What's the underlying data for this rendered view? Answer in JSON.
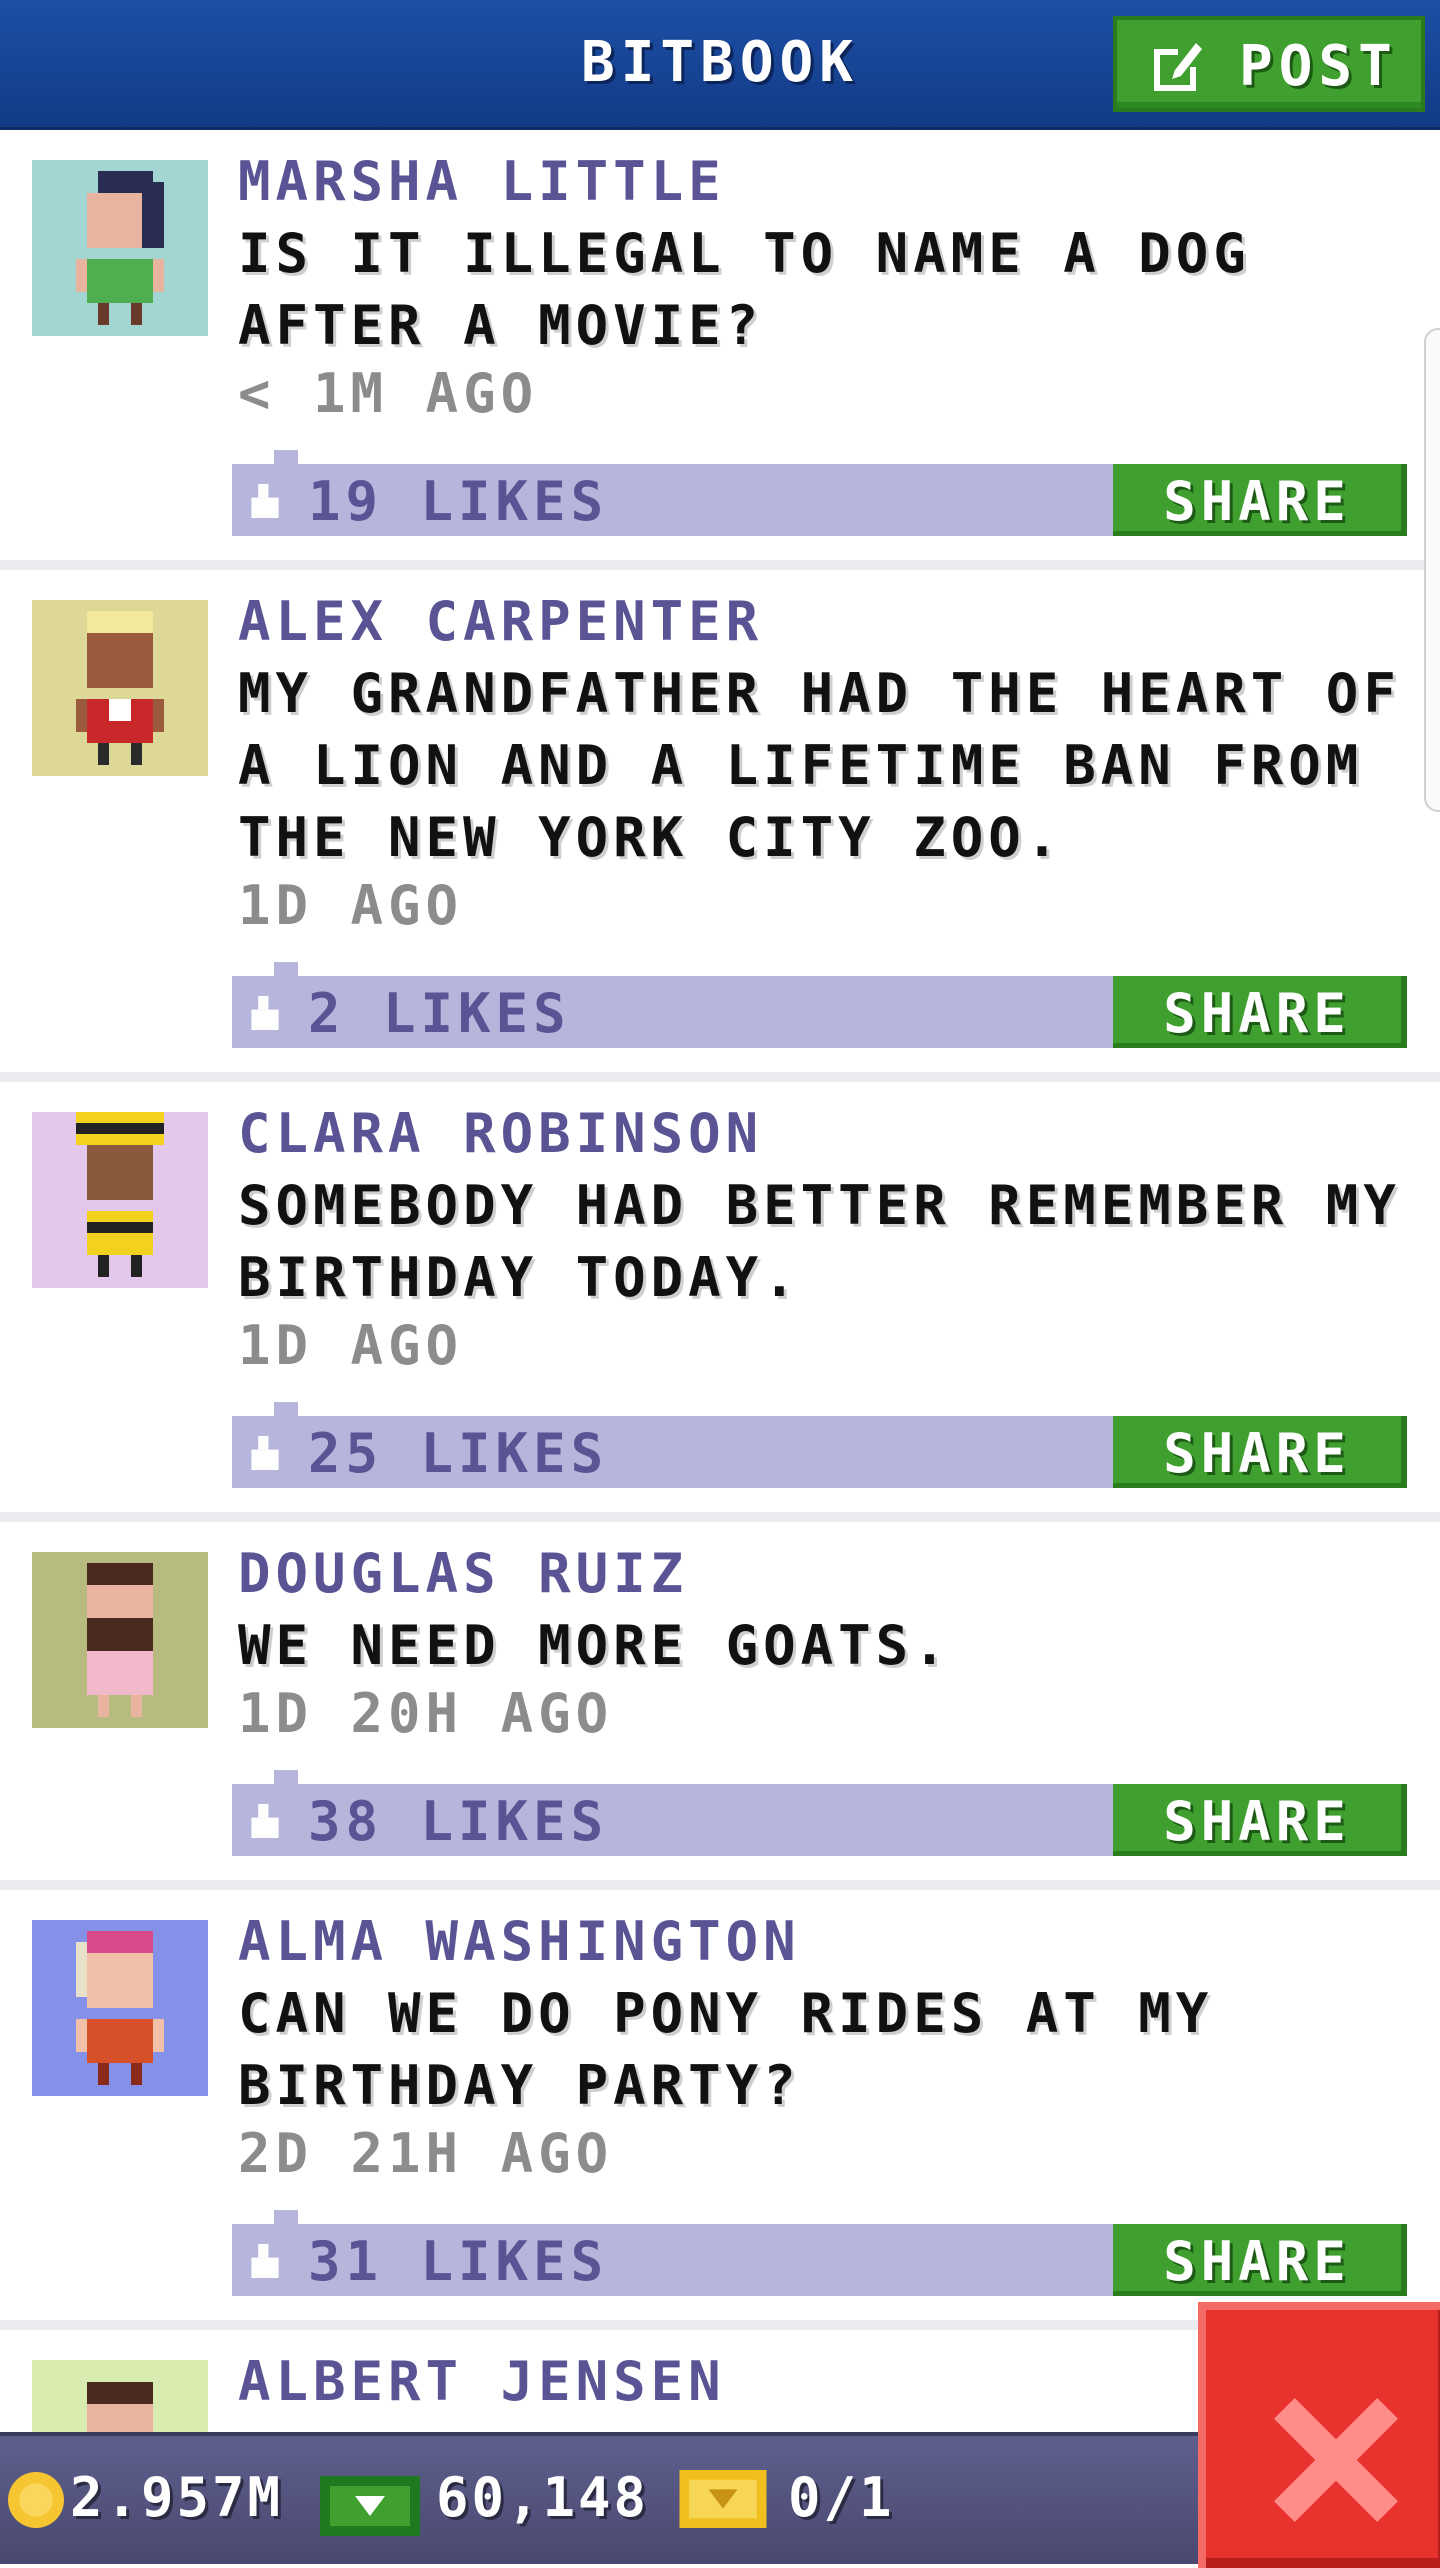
{
  "header": {
    "title": "BITBOOK",
    "post_label": "POST",
    "post_icon": "edit-icon"
  },
  "posts": [
    {
      "author": "MARSHA LITTLE",
      "message": "IS IT ILLEGAL TO NAME A DOG AFTER A MOVIE?",
      "time": "< 1M AGO",
      "likes": "19 LIKES",
      "share_label": "SHARE",
      "avatar_bg": "#a3d6d2"
    },
    {
      "author": "ALEX CARPENTER",
      "message": "MY GRANDFATHER HAD THE HEART OF A LION AND A LIFETIME BAN FROM THE NEW YORK CITY ZOO.",
      "time": "1D AGO",
      "likes": "2 LIKES",
      "share_label": "SHARE",
      "avatar_bg": "#ddd898"
    },
    {
      "author": "CLARA ROBINSON",
      "message": "SOMEBODY HAD BETTER REMEMBER MY BIRTHDAY TODAY.",
      "time": "1D AGO",
      "likes": "25 LIKES",
      "share_label": "SHARE",
      "avatar_bg": "#e4c8ec"
    },
    {
      "author": "DOUGLAS RUIZ",
      "message": "WE NEED MORE GOATS.",
      "time": "1D 20H AGO",
      "likes": "38 LIKES",
      "share_label": "SHARE",
      "avatar_bg": "#b7bb80"
    },
    {
      "author": "ALMA WASHINGTON",
      "message": "CAN WE DO PONY RIDES AT MY BIRTHDAY PARTY?",
      "time": "2D 21H AGO",
      "likes": "31 LIKES",
      "share_label": "SHARE",
      "avatar_bg": "#8590e8"
    },
    {
      "author": "ALBERT JENSEN",
      "avatar_bg": "#d9ecb0"
    }
  ],
  "status_bar": {
    "coins": "2.957M",
    "bux": "60,148",
    "tickets": "0/1"
  },
  "colors": {
    "header": "#1d4fa6",
    "accent_green": "#3fa02f",
    "like_bar": "#b6b6dc",
    "close_red": "#e8322e"
  },
  "icons": {
    "like": "thumb-up-icon",
    "coin": "coin-icon",
    "bux": "bux-icon",
    "ticket": "ticket-icon",
    "close": "close-icon"
  }
}
